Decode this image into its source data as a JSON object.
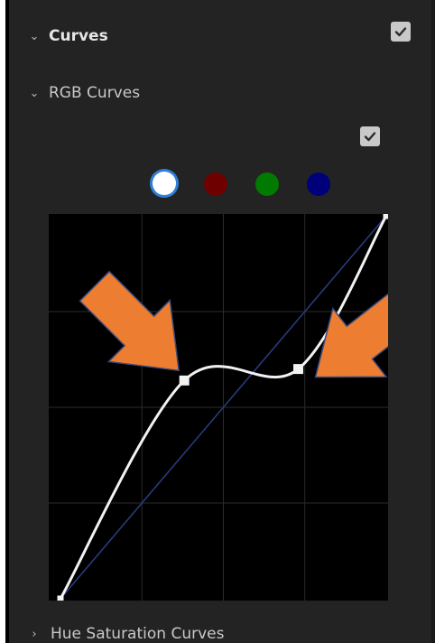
{
  "panel": {
    "curves": {
      "label": "Curves",
      "enabled": true
    },
    "rgb_curves": {
      "label": "RGB Curves",
      "enabled": true
    },
    "hue_saturation": {
      "label": "Hue Saturation Curves"
    }
  },
  "channels": [
    {
      "name": "white",
      "color": "#ffffff",
      "selected": true
    },
    {
      "name": "red",
      "color": "#6e0000",
      "selected": false
    },
    {
      "name": "green",
      "color": "#007a00",
      "selected": false
    },
    {
      "name": "blue",
      "color": "#00007a",
      "selected": false
    }
  ],
  "curve": {
    "control_points": [
      {
        "input": 0,
        "output": 0
      },
      {
        "input": 0.38,
        "output": 0.57
      },
      {
        "input": 0.73,
        "output": 0.6
      },
      {
        "input": 1,
        "output": 1
      }
    ],
    "diagonal_color": "#2a3a7a",
    "curve_color": "#f2f2f2",
    "arrow_color": "#ed7d31"
  }
}
